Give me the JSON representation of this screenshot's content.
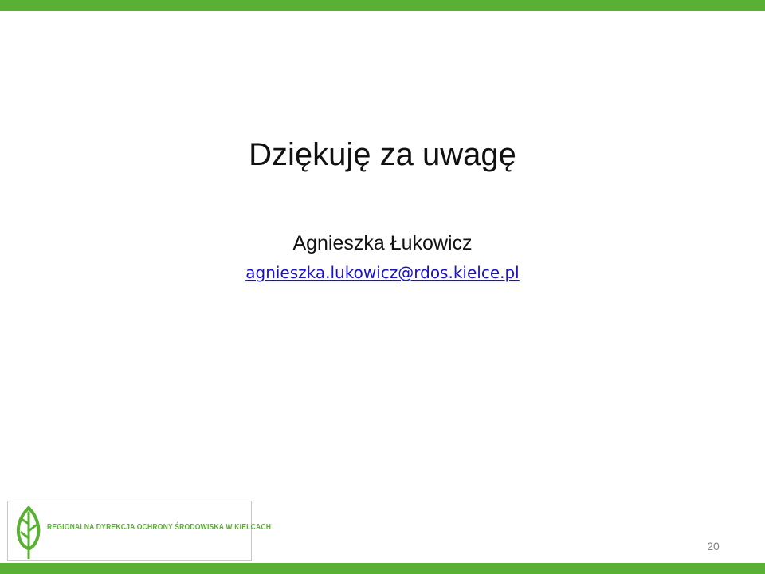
{
  "slide": {
    "title": "Dziękuję za uwagę",
    "author_name": "Agnieszka Łukowicz",
    "email": "agnieszka.lukowicz@rdos.kielce.pl",
    "page_number": "20"
  },
  "logo": {
    "text": "REGIONALNA DYREKCJA OCHRONY ŚRODOWISKA W KIELCACH",
    "icon": "leaf-icon"
  },
  "colors": {
    "accent_bar": "#5ab033",
    "link": "#1a13c6",
    "text": "#111111"
  }
}
